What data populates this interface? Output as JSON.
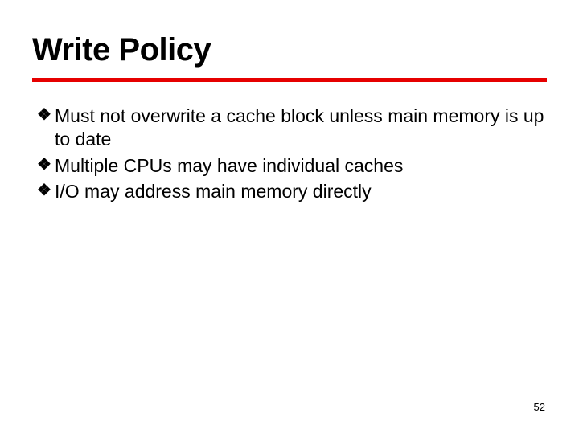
{
  "title": "Write Policy",
  "bullets": [
    {
      "icon": "❖",
      "text": "Must not overwrite a cache block unless main memory is up to date"
    },
    {
      "icon": "❖",
      "text": "Multiple CPUs may have individual caches"
    },
    {
      "icon": "❖",
      "text": "I/O may address main memory directly"
    }
  ],
  "page_number": "52"
}
